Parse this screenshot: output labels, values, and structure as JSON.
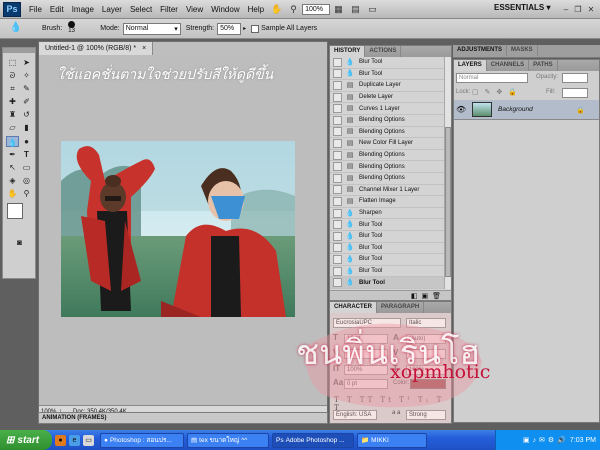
{
  "menu": {
    "logo": "Ps",
    "items": [
      "File",
      "Edit",
      "Image",
      "Layer",
      "Select",
      "Filter",
      "View",
      "Window",
      "Help"
    ],
    "zoom": "100%",
    "workspace": "ESSENTIALS ▾"
  },
  "options": {
    "brush_label": "Brush:",
    "brush_size": "13",
    "mode_label": "Mode:",
    "mode_value": "Normal",
    "strength_label": "Strength:",
    "strength_value": "50%",
    "sample_all_layers": "Sample All Layers"
  },
  "document": {
    "tab": "Untitled-1 @ 100% (RGB/8) *",
    "caption": "ใช้แอคชั่นตามใจช่วยปรับสีให้ดูดีขึ้น",
    "zoom": "100%",
    "doc_info": "Doc: 350.4K/350.4K"
  },
  "animation_panel": {
    "label": "ANIMATION (FRAMES)"
  },
  "history": {
    "tabs": [
      "HISTORY",
      "ACTIONS"
    ],
    "items": [
      {
        "label": "Blur Tool",
        "icon": "blur-icon"
      },
      {
        "label": "Blur Tool",
        "icon": "blur-icon"
      },
      {
        "label": "Duplicate Layer",
        "icon": "doc-icon"
      },
      {
        "label": "Delete Layer",
        "icon": "doc-icon"
      },
      {
        "label": "Curves 1 Layer",
        "icon": "doc-icon"
      },
      {
        "label": "Blending Options",
        "icon": "doc-icon"
      },
      {
        "label": "Blending Options",
        "icon": "doc-icon"
      },
      {
        "label": "New Color Fill Layer",
        "icon": "doc-icon"
      },
      {
        "label": "Blending Options",
        "icon": "doc-icon"
      },
      {
        "label": "Blending Options",
        "icon": "doc-icon"
      },
      {
        "label": "Blending Options",
        "icon": "doc-icon"
      },
      {
        "label": "Channel Mixer 1 Layer",
        "icon": "doc-icon"
      },
      {
        "label": "Flatten Image",
        "icon": "doc-icon"
      },
      {
        "label": "Sharpen",
        "icon": "blur-icon"
      },
      {
        "label": "Blur Tool",
        "icon": "blur-icon"
      },
      {
        "label": "Blur Tool",
        "icon": "blur-icon"
      },
      {
        "label": "Blur Tool",
        "icon": "blur-icon"
      },
      {
        "label": "Blur Tool",
        "icon": "blur-icon"
      },
      {
        "label": "Blur Tool",
        "icon": "blur-icon"
      },
      {
        "label": "Blur Tool",
        "icon": "blur-icon"
      }
    ]
  },
  "character": {
    "tabs": [
      "CHARACTER",
      "PARAGRAPH"
    ],
    "font": "EucrosiaUPC",
    "style": "Italic",
    "size": "18 pt",
    "leading": "(Auto)",
    "kerning": "0",
    "vscale": "100%",
    "hscale": "100%",
    "baseline": "0 pt",
    "color_label": "Color:",
    "language": "English: USA",
    "antialias": "Strong",
    "aa_label": "a a"
  },
  "adjustments": {
    "tabs": [
      "ADJUSTMENTS",
      "MASKS"
    ]
  },
  "layers": {
    "tabs": [
      "LAYERS",
      "CHANNELS",
      "PATHS"
    ],
    "blend": "Normal",
    "opacity_label": "Opacity:",
    "lock_label": "Lock:",
    "fill_label": "Fill:",
    "layer_name": "Background"
  },
  "watermark": {
    "thai": "ชนพิ่นเรินโฮ",
    "latin": "xopmhotic"
  },
  "taskbar": {
    "start": "start",
    "tasks": [
      "Photoshop : สอนปร...",
      "tex ขนาดใหญ่ ^^",
      "Adobe Photoshop ...",
      "MIKKI"
    ],
    "clock": "7:03 PM"
  },
  "colors": {
    "history_selected": "#c6c6c6",
    "character_tint": "#e9b8b8",
    "watermark": "#c4123a",
    "taskbar": "#245edb"
  }
}
